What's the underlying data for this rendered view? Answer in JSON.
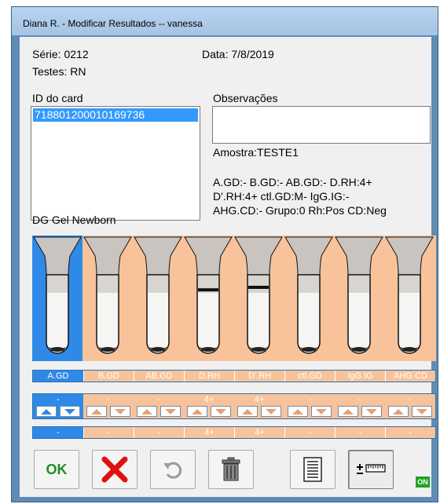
{
  "window": {
    "title": "Diana R. - Modificar Resultados -- vanessa"
  },
  "info": {
    "serie": "Série: 0212",
    "data": "Data: 7/8/2019",
    "testes": "Testes: RN"
  },
  "card": {
    "label": "ID do card",
    "items": [
      "718801200010169736"
    ]
  },
  "observacoes": {
    "label": "Observações",
    "value": "",
    "amostra": "Amostra:TESTE1",
    "results_line1": "A.GD:-   B.GD:-   AB.GD:-   D.RH:4+",
    "results_line2": "D'.RH:4+   ctl.GD:M-   IgG.IG:-",
    "results_line3": "AHG.CD:-   Grupo:0   Rh:Pos   CD:Neg"
  },
  "gel": {
    "label": "DG Gel Newborn",
    "selected_index": 0,
    "wells": [
      {
        "name": "A.GD",
        "reaction": "-",
        "result": "-",
        "band_level": null
      },
      {
        "name": "B.GD",
        "reaction": "-",
        "result": "-",
        "band_level": null
      },
      {
        "name": "AB.GD",
        "reaction": "-",
        "result": "-",
        "band_level": null
      },
      {
        "name": "D.RH",
        "reaction": "4+",
        "result": "4+",
        "band_level": 0.62
      },
      {
        "name": "D'.RH",
        "reaction": "4+",
        "result": "4+",
        "band_level": 0.6
      },
      {
        "name": "ctl.GD",
        "reaction": "-",
        "result": "-",
        "band_level": null
      },
      {
        "name": "IgG.IG",
        "reaction": "-",
        "result": "-",
        "band_level": null
      },
      {
        "name": "AHG.CD",
        "reaction": "-",
        "result": "-",
        "band_level": null
      }
    ]
  },
  "toolbar": {
    "ok_label": "OK",
    "status_badge": "ON",
    "buttons": [
      "ok-icon",
      "cancel-x-icon",
      "undo-icon",
      "trash-icon",
      "report-icon",
      "plus-minus-ruler-icon"
    ]
  },
  "colors": {
    "selected": "#2e8ae6",
    "panel": "#f8c39a",
    "ok_green": "#1e8f1e",
    "cancel_red": "#e01010",
    "on_badge": "#1fa31f"
  }
}
